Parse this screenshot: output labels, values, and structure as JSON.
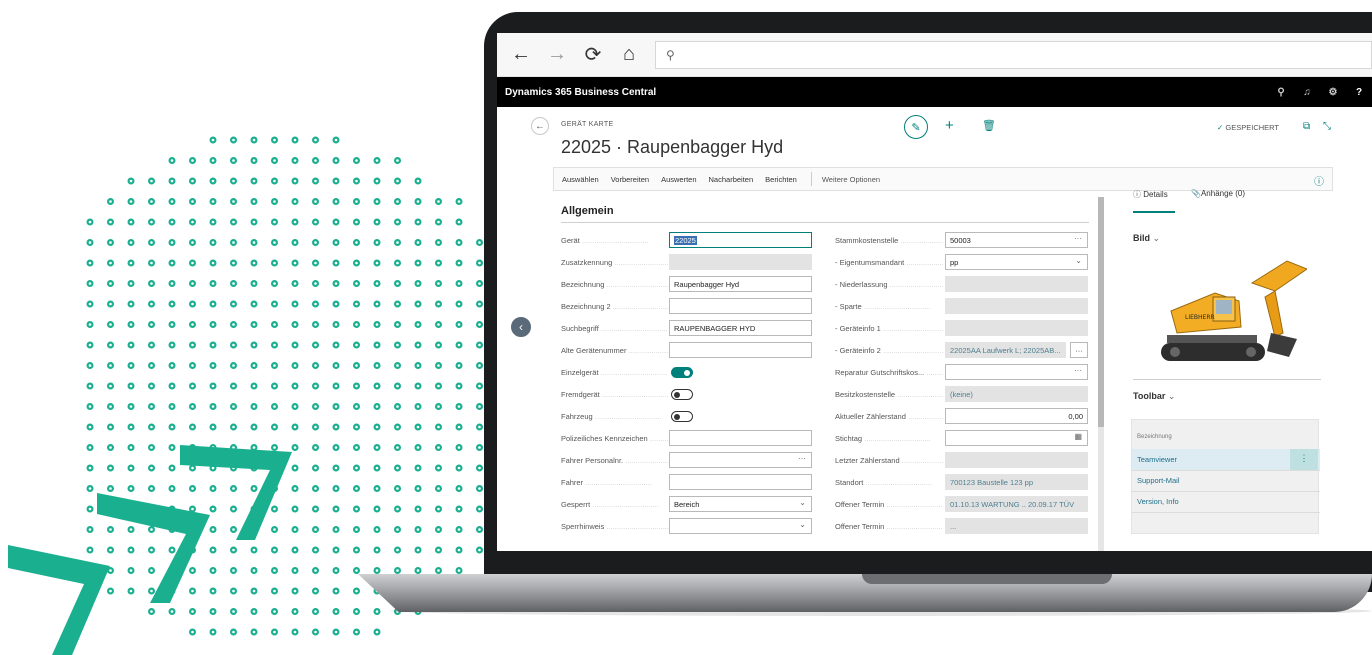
{
  "browser": {
    "back_icon": "←",
    "forward_icon": "→",
    "reload_icon": "⟳",
    "home_icon": "⌂",
    "search_icon": "⚲"
  },
  "app": {
    "title": "Dynamics 365 Business Central",
    "search_icon": "⚲",
    "bell_icon": "♫",
    "gear_icon": "⚙",
    "help_icon": "?"
  },
  "card": {
    "type_label": "GERÄT KARTE",
    "title": "22025 · Raupenbagger Hyd",
    "saved_label": "GESPEICHERT",
    "saved_check": "✓"
  },
  "actions": [
    "Auswählen",
    "Vorbereiten",
    "Auswerten",
    "Nacharbeiten",
    "Berichten"
  ],
  "more_options": "Weitere Optionen",
  "section": {
    "title": "Allgemein"
  },
  "left_fields": [
    {
      "label": "Gerät",
      "value": "22025"
    },
    {
      "label": "Zusatzkennung",
      "value": ""
    },
    {
      "label": "Bezeichnung",
      "value": "Raupenbagger Hyd"
    },
    {
      "label": "Bezeichnung 2",
      "value": ""
    },
    {
      "label": "Suchbegriff",
      "value": "RAUPENBAGGER HYD"
    },
    {
      "label": "Alte Gerätenummer",
      "value": ""
    },
    {
      "label": "Einzelgerät",
      "value": "on"
    },
    {
      "label": "Fremdgerät",
      "value": "off"
    },
    {
      "label": "Fahrzeug",
      "value": "off"
    },
    {
      "label": "Polizeiliches Kennzeichen",
      "value": ""
    },
    {
      "label": "Fahrer Personalnr.",
      "value": ""
    },
    {
      "label": "Fahrer",
      "value": ""
    },
    {
      "label": "Gesperrt",
      "value": "Bereich"
    },
    {
      "label": "Sperrhinweis",
      "value": ""
    }
  ],
  "right_fields": [
    {
      "label": "Stammkostenstelle",
      "value": "50003"
    },
    {
      "label": "- Eigentumsmandant",
      "value": "pp"
    },
    {
      "label": "- Niederlassung",
      "value": ""
    },
    {
      "label": "- Sparte",
      "value": ""
    },
    {
      "label": "- Geräteinfo 1",
      "value": ""
    },
    {
      "label": "- Geräteinfo 2",
      "value": "22025AA Laufwerk L; 22025AB..."
    },
    {
      "label": "Reparatur Gutschriftskos...",
      "value": ""
    },
    {
      "label": "Besitzkostenstelle",
      "value": "(keine)"
    },
    {
      "label": "Aktueller Zählerstand",
      "value": "0,00"
    },
    {
      "label": "Stichtag",
      "value": ""
    },
    {
      "label": "Letzter Zählerstand",
      "value": ""
    },
    {
      "label": "Standort",
      "value": "700123 Baustelle 123 pp"
    },
    {
      "label": "Offener Termin",
      "value": "01.10.13 WARTUNG .. 20.09.17 TÜV"
    },
    {
      "label": "Offener Termin",
      "value": "..."
    }
  ],
  "factbox": {
    "tab_details": "Details",
    "tab_attachments": "Anhänge (0)",
    "image_heading": "Bild",
    "toolbar_heading": "Toolbar",
    "toolbar_column": "Bezeichnung",
    "toolbar_items": [
      "Teamviewer",
      "Support-Mail",
      "Version, Info"
    ]
  },
  "colors": {
    "accent": "#00807a",
    "decor_green": "#1aaf8f",
    "link": "#1f6f8b"
  }
}
